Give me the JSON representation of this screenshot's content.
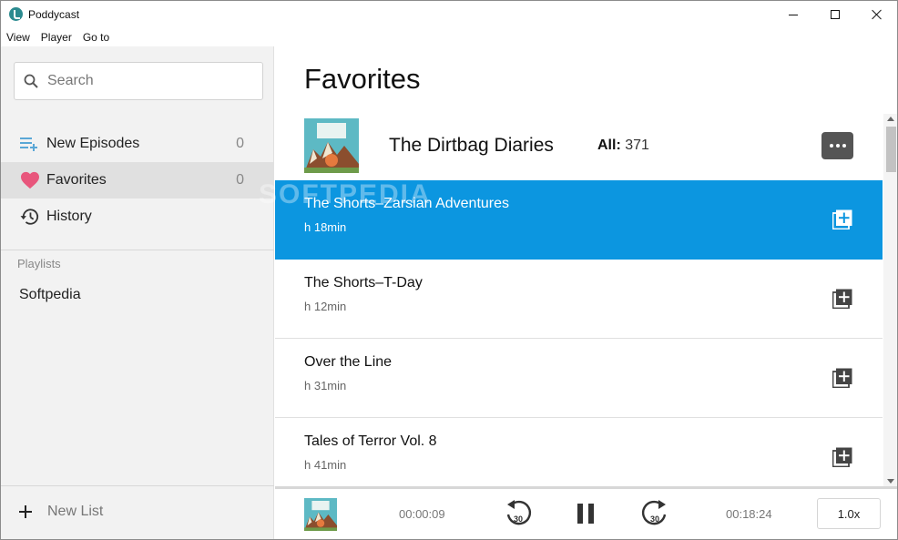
{
  "window": {
    "title": "Poddycast"
  },
  "menu": [
    "View",
    "Player",
    "Go to"
  ],
  "search": {
    "placeholder": "Search",
    "value": ""
  },
  "nav": [
    {
      "label": "New Episodes",
      "count": "0",
      "icon": "new-episodes-icon"
    },
    {
      "label": "Favorites",
      "count": "0",
      "icon": "heart-icon"
    },
    {
      "label": "History",
      "icon": "history-icon"
    }
  ],
  "playlists": {
    "heading": "Playlists",
    "items": [
      "Softpedia"
    ]
  },
  "new_list": {
    "label": "New List"
  },
  "main": {
    "title": "Favorites",
    "podcast": {
      "title": "The Dirtbag Diaries",
      "all_label": "All:",
      "all_count": "371"
    },
    "episodes": [
      {
        "title": "The Shorts–Zarsian Adventures",
        "duration": "h 18min",
        "selected": true
      },
      {
        "title": "The Shorts–T-Day",
        "duration": "h 12min"
      },
      {
        "title": "Over the Line",
        "duration": "h 31min"
      },
      {
        "title": "Tales of Terror Vol. 8",
        "duration": "h 41min"
      }
    ]
  },
  "player": {
    "elapsed": "00:00:09",
    "total": "00:18:24",
    "rewind_seconds": "30",
    "forward_seconds": "30",
    "speed": "1.0x"
  },
  "watermark": "SOFTPEDIA",
  "colors": {
    "accent": "#0c96e0",
    "heart": "#e8567c",
    "cover_teal": "#5db9c4"
  }
}
